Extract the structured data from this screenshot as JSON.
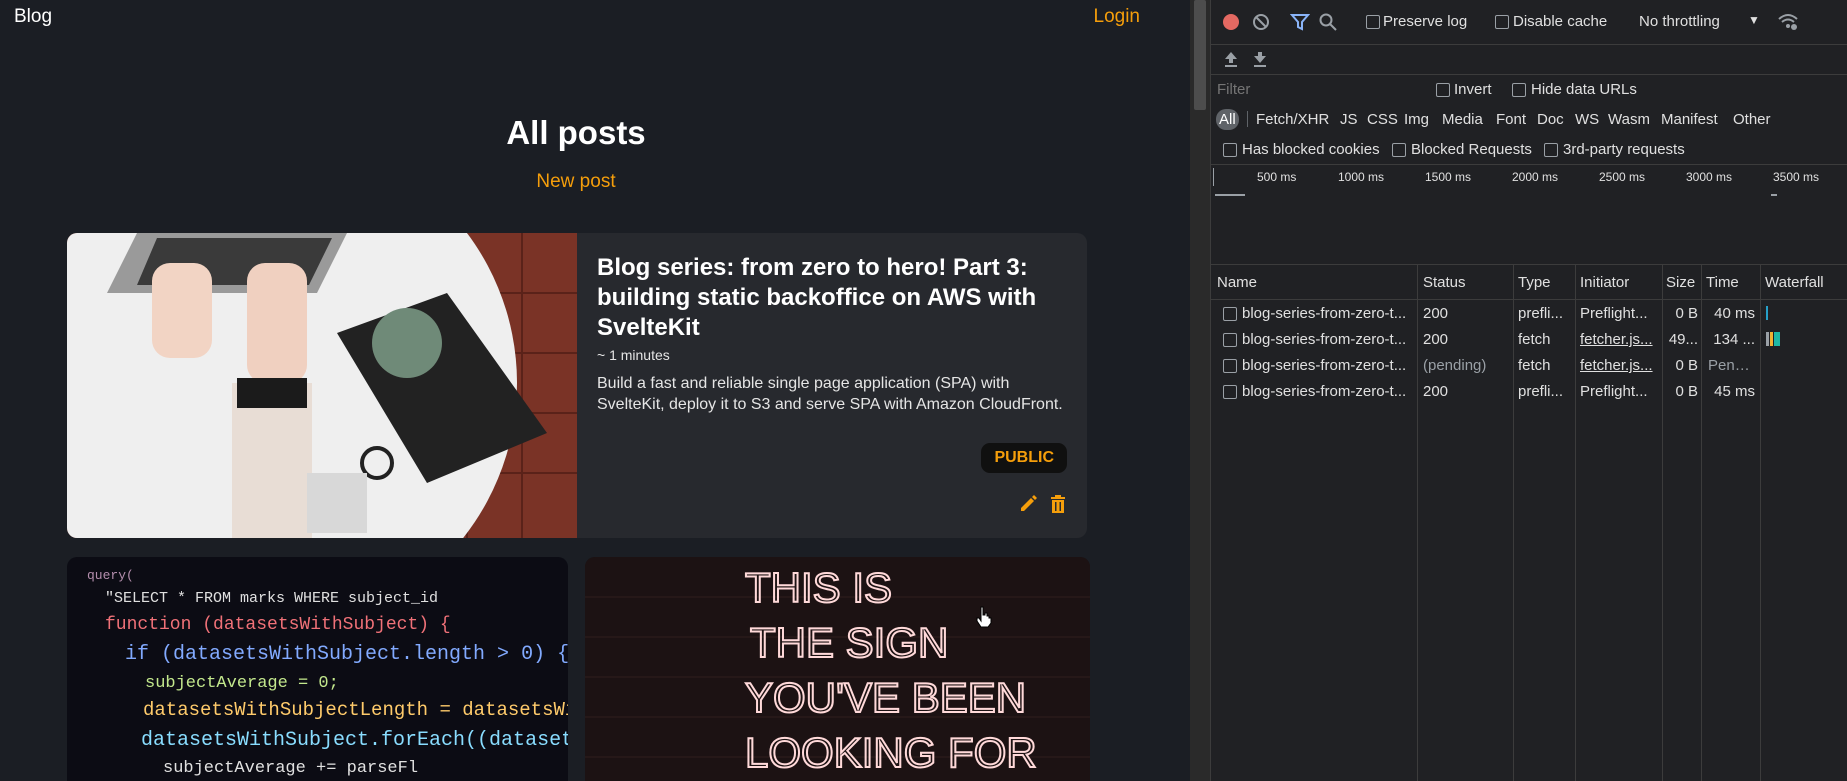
{
  "app": {
    "brand": "Blog",
    "login": "Login",
    "page_title": "All posts",
    "new_post": "New post",
    "post": {
      "title": "Blog series: from zero to hero! Part 3: building static backoffice on AWS with SvelteKit",
      "read_time": "~ 1 minutes",
      "description": "Build a fast and reliable single page application (SPA) with SvelteKit, deploy it to S3 and serve SPA with Amazon CloudFront.",
      "badge": "PUBLIC"
    },
    "code_tile_lines": [
      "query(",
      "\"SELECT * FROM marks WHERE subject_id",
      "function (datasetsWithSubject) {",
      "if (datasetsWithSubject.length > 0) {",
      "subjectAverage = 0;",
      "datasetsWithSubjectLength = datasetsWithSu",
      "datasetsWithSubject.forEach((dataset) => {",
      "subjectAverage += parseFl"
    ],
    "sign_tile_lines": [
      "THIS IS",
      "THE SIGN",
      "YOU'VE BEEN",
      "LOOKING FOR"
    ],
    "accent": "#f59e0b"
  },
  "devtools": {
    "toolbar": {
      "preserve_log": "Preserve log",
      "disable_cache": "Disable cache",
      "throttling": "No throttling"
    },
    "filter": {
      "placeholder": "Filter",
      "invert": "Invert",
      "hide_data_urls": "Hide data URLs"
    },
    "types": [
      "All",
      "Fetch/XHR",
      "JS",
      "CSS",
      "Img",
      "Media",
      "Font",
      "Doc",
      "WS",
      "Wasm",
      "Manifest",
      "Other"
    ],
    "blocked": {
      "has_blocked_cookies": "Has blocked cookies",
      "blocked_requests": "Blocked Requests",
      "third_party": "3rd-party requests"
    },
    "timeline_ticks": [
      "500 ms",
      "1000 ms",
      "1500 ms",
      "2000 ms",
      "2500 ms",
      "3000 ms",
      "3500 ms"
    ],
    "columns": {
      "name": "Name",
      "status": "Status",
      "type": "Type",
      "initiator": "Initiator",
      "size": "Size",
      "time": "Time",
      "waterfall": "Waterfall"
    },
    "requests": [
      {
        "name": "blog-series-from-zero-t...",
        "status": "200",
        "type": "prefli...",
        "initiator": "Preflight...",
        "size": "0 B",
        "time": "40 ms"
      },
      {
        "name": "blog-series-from-zero-t...",
        "status": "200",
        "type": "fetch",
        "initiator": "fetcher.js...",
        "size": "49...",
        "time": "134 ..."
      },
      {
        "name": "blog-series-from-zero-t...",
        "status": "(pending)",
        "type": "fetch",
        "initiator": "fetcher.js...",
        "size": "0 B",
        "time": "Pend..."
      },
      {
        "name": "blog-series-from-zero-t...",
        "status": "200",
        "type": "prefli...",
        "initiator": "Preflight...",
        "size": "0 B",
        "time": "45 ms"
      }
    ]
  }
}
